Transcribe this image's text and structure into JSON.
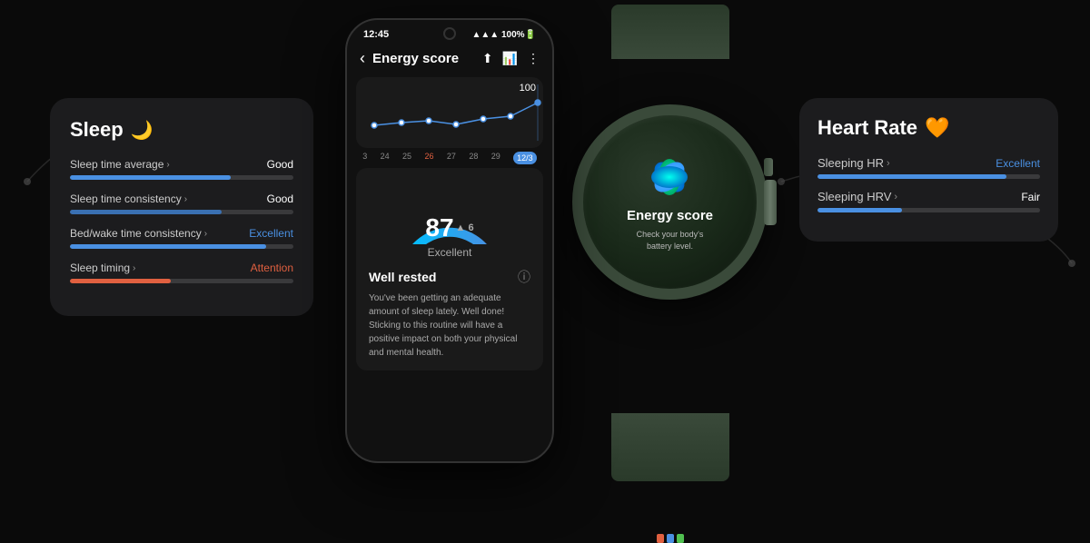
{
  "background_color": "#0a0a0a",
  "sleep_card": {
    "title": "Sleep",
    "moon_icon": "🌙",
    "metrics": [
      {
        "label": "Sleep time average",
        "value": "Good",
        "value_class": "",
        "fill_width": "72",
        "fill_color": "fill-blue"
      },
      {
        "label": "Sleep time consistency",
        "value": "Good",
        "value_class": "",
        "fill_width": "68",
        "fill_color": "fill-blue-dark"
      },
      {
        "label": "Bed/wake time consistency",
        "value": "Excellent",
        "value_class": "excellent",
        "fill_width": "88",
        "fill_color": "fill-blue"
      },
      {
        "label": "Sleep timing",
        "value": "Attention",
        "value_class": "attention",
        "fill_width": "45",
        "fill_color": "fill-orange"
      }
    ]
  },
  "phone": {
    "time": "12:45",
    "signal": "▲ 100%",
    "title": "Energy score",
    "chart_score_label": "100",
    "dates": [
      "3",
      "24",
      "25",
      "26",
      "27",
      "28",
      "29",
      "12/3"
    ],
    "active_date": "12/3",
    "score_value": "87",
    "score_delta": "▲ 6",
    "score_label": "Excellent",
    "well_rested_title": "Well rested",
    "well_rested_body": "You've been getting an adequate amount of sleep lately. Well done! Sticking to this routine will have a positive impact on both your physical and mental health."
  },
  "watch": {
    "app_name": "Energy score",
    "app_sub": "Check your body's\nbattery level.",
    "band_accents": [
      {
        "color": "#e06040"
      },
      {
        "color": "#4a90e2"
      },
      {
        "color": "#50c050"
      }
    ]
  },
  "heart_card": {
    "title": "Heart Rate",
    "heart_icon": "🧡",
    "metrics": [
      {
        "label": "Sleeping HR",
        "value": "Excellent",
        "value_class": "excellent",
        "fill_width": "85",
        "fill_color": "fill-blue"
      },
      {
        "label": "Sleeping HRV",
        "value": "Fair",
        "value_class": "",
        "fill_width": "38",
        "fill_color": "fill-blue"
      }
    ]
  }
}
